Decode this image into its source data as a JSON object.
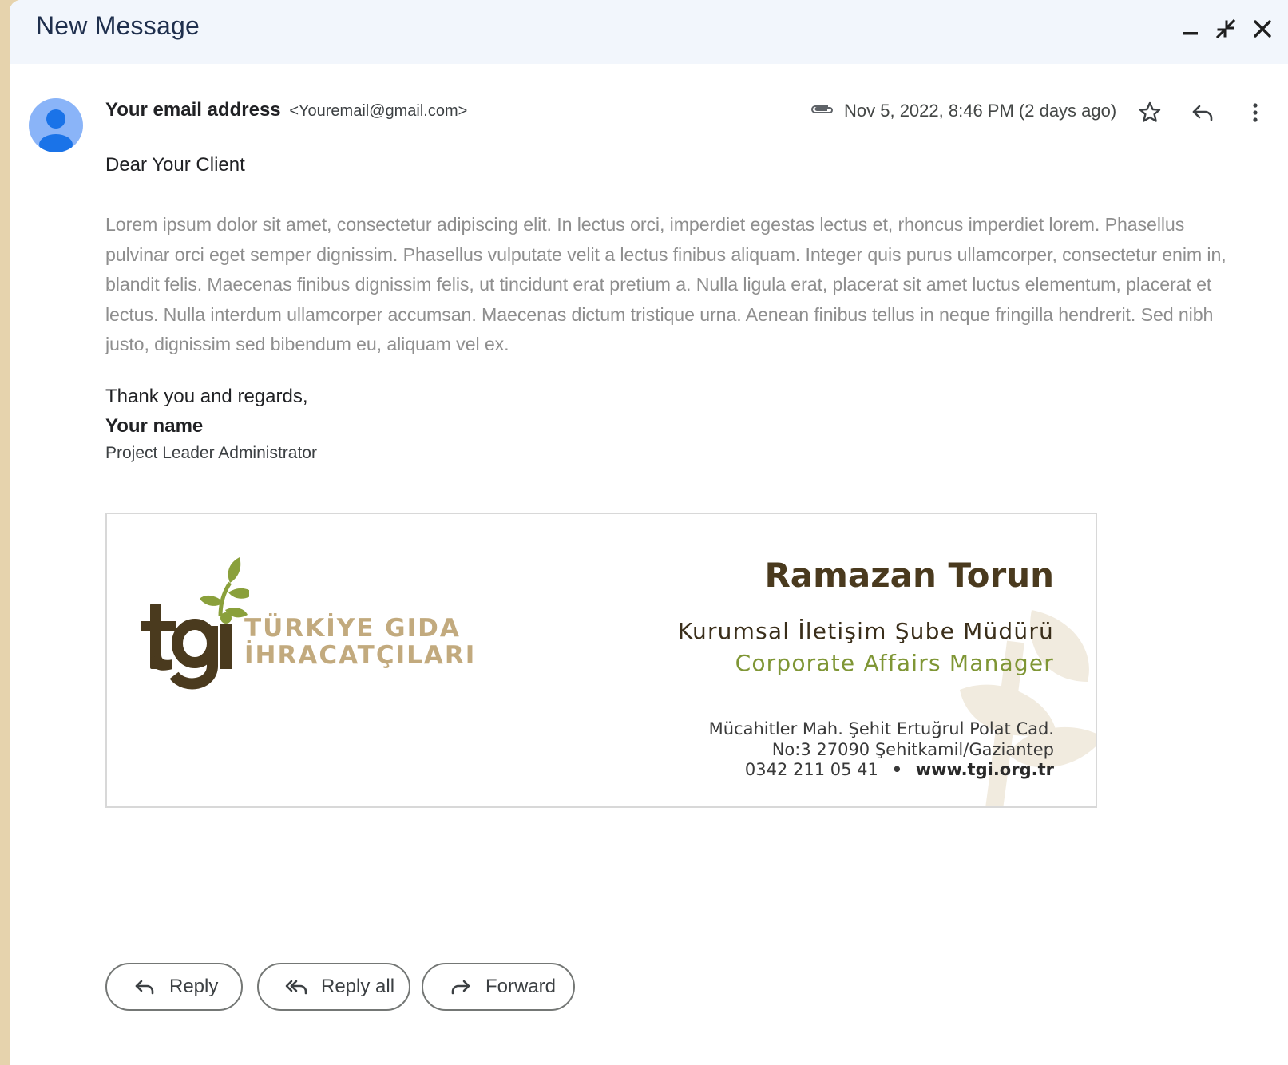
{
  "window": {
    "title": "New Message"
  },
  "colors": {
    "titlebar_bg": "#f2f6fc",
    "avatar": "#8ab4f8",
    "brand_dark": "#4a3a1e",
    "brand_gold": "#c2aa7e",
    "brand_green": "#7f9635"
  },
  "icons": {
    "minimize": "minimize-icon",
    "collapse": "collapse-icon",
    "close": "close-icon",
    "attachment": "paperclip-icon",
    "star": "star-icon",
    "reply": "reply-icon",
    "more": "more-vert-icon",
    "reply_all": "reply-all-icon",
    "forward": "forward-icon"
  },
  "message": {
    "sender_name": "Your email address",
    "sender_email": "<Youremail@gmail.com>",
    "date": "Nov 5, 2022, 8:46 PM (2 days ago)",
    "greeting": "Dear Your Client",
    "body": "Lorem ipsum dolor sit amet, consectetur adipiscing elit. In lectus orci, imperdiet egestas lectus et, rhoncus imperdiet lorem. Phasellus pulvinar orci eget semper dignissim. Phasellus vulputate velit a lectus finibus aliquam. Integer quis purus ullamcorper, consectetur enim in, blandit felis. Maecenas finibus dignissim felis, ut tincidunt erat pretium a. Nulla ligula erat, placerat sit amet luctus elementum, placerat et lectus. Nulla interdum ullamcorper accumsan. Maecenas dictum tristique urna. Aenean finibus tellus in neque fringilla hendrerit. Sed nibh justo, dignissim sed bibendum eu, aliquam vel ex.",
    "closing": "Thank you and regards,",
    "your_name": "Your name",
    "role": "Project Leader Administrator"
  },
  "signature": {
    "logo_text": "tgi",
    "org_line1": "TÜRKİYE GIDA",
    "org_line2": "İHRACATÇILARI",
    "person_name": "Ramazan Torun",
    "title_tr": "Kurumsal İletişim Şube Müdürü",
    "title_en": "Corporate Affairs Manager",
    "address_line1": "Mücahitler Mah. Şehit Ertuğrul Polat Cad.",
    "address_line2": "No:3 27090 Şehitkamil/Gaziantep",
    "phone": "0342 211 05 41",
    "separator": "•",
    "website": "www.tgi.org.tr"
  },
  "actions": {
    "reply": "Reply",
    "reply_all": "Reply all",
    "forward": "Forward"
  }
}
